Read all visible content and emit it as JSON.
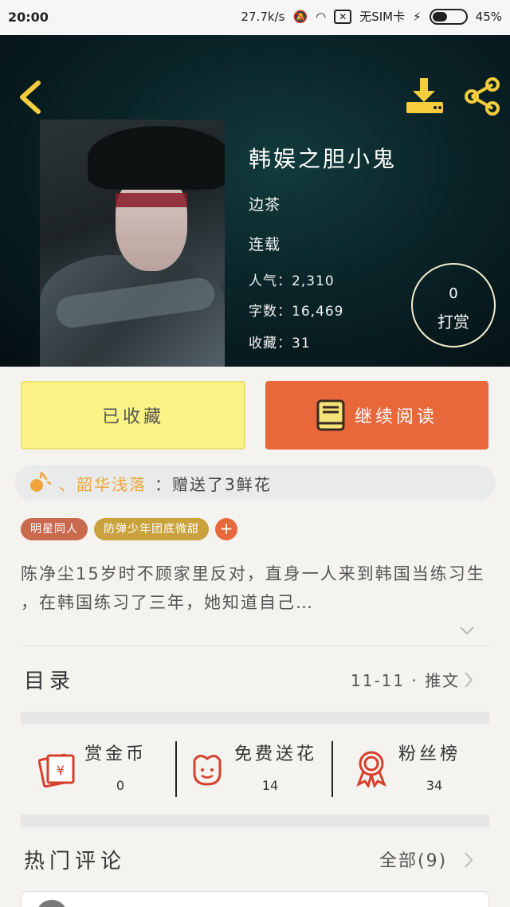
{
  "status_bar": {
    "time": "20:00",
    "net_speed": "27.7k/s",
    "sim": "无SIM卡",
    "battery": "45%",
    "battery_level": 0.45
  },
  "book": {
    "title": "韩娱之胆小鬼",
    "author": "边茶",
    "status": "连载",
    "popularity": "人气：2,310",
    "word_count": "字数：16,469",
    "favorites": "收藏：31"
  },
  "tip": {
    "count": "0",
    "label": "打赏"
  },
  "actions": {
    "favorited_label": "已收藏",
    "continue_label": "继续阅读"
  },
  "gift_banner": {
    "user": "、韶华浅落",
    "text": "：赠送了3鲜花"
  },
  "tags": [
    "明星同人",
    "防弹少年团底微甜"
  ],
  "tag_add": "+",
  "description": "陈净尘15岁时不顾家里反对，直身一人来到韩国当练习生 ，在韩国练习了三年，她知道自己…",
  "toc": {
    "label": "目录",
    "update": "11-11 · 推文"
  },
  "stats": [
    {
      "label": "赏金币",
      "value": "0",
      "icon": "red-envelope-icon"
    },
    {
      "label": "免费送花",
      "value": "14",
      "icon": "flower-icon"
    },
    {
      "label": "粉丝榜",
      "value": "34",
      "icon": "award-ribbon-icon"
    }
  ],
  "comments": {
    "label": "热门评论",
    "all": "全部(9)"
  },
  "colors": {
    "accent_orange": "#e8683c",
    "fav_yellow": "#fbf286",
    "gift_user": "#f0a43c",
    "icon_gold": "#f5cd3d",
    "stat_red": "#d6402c"
  }
}
